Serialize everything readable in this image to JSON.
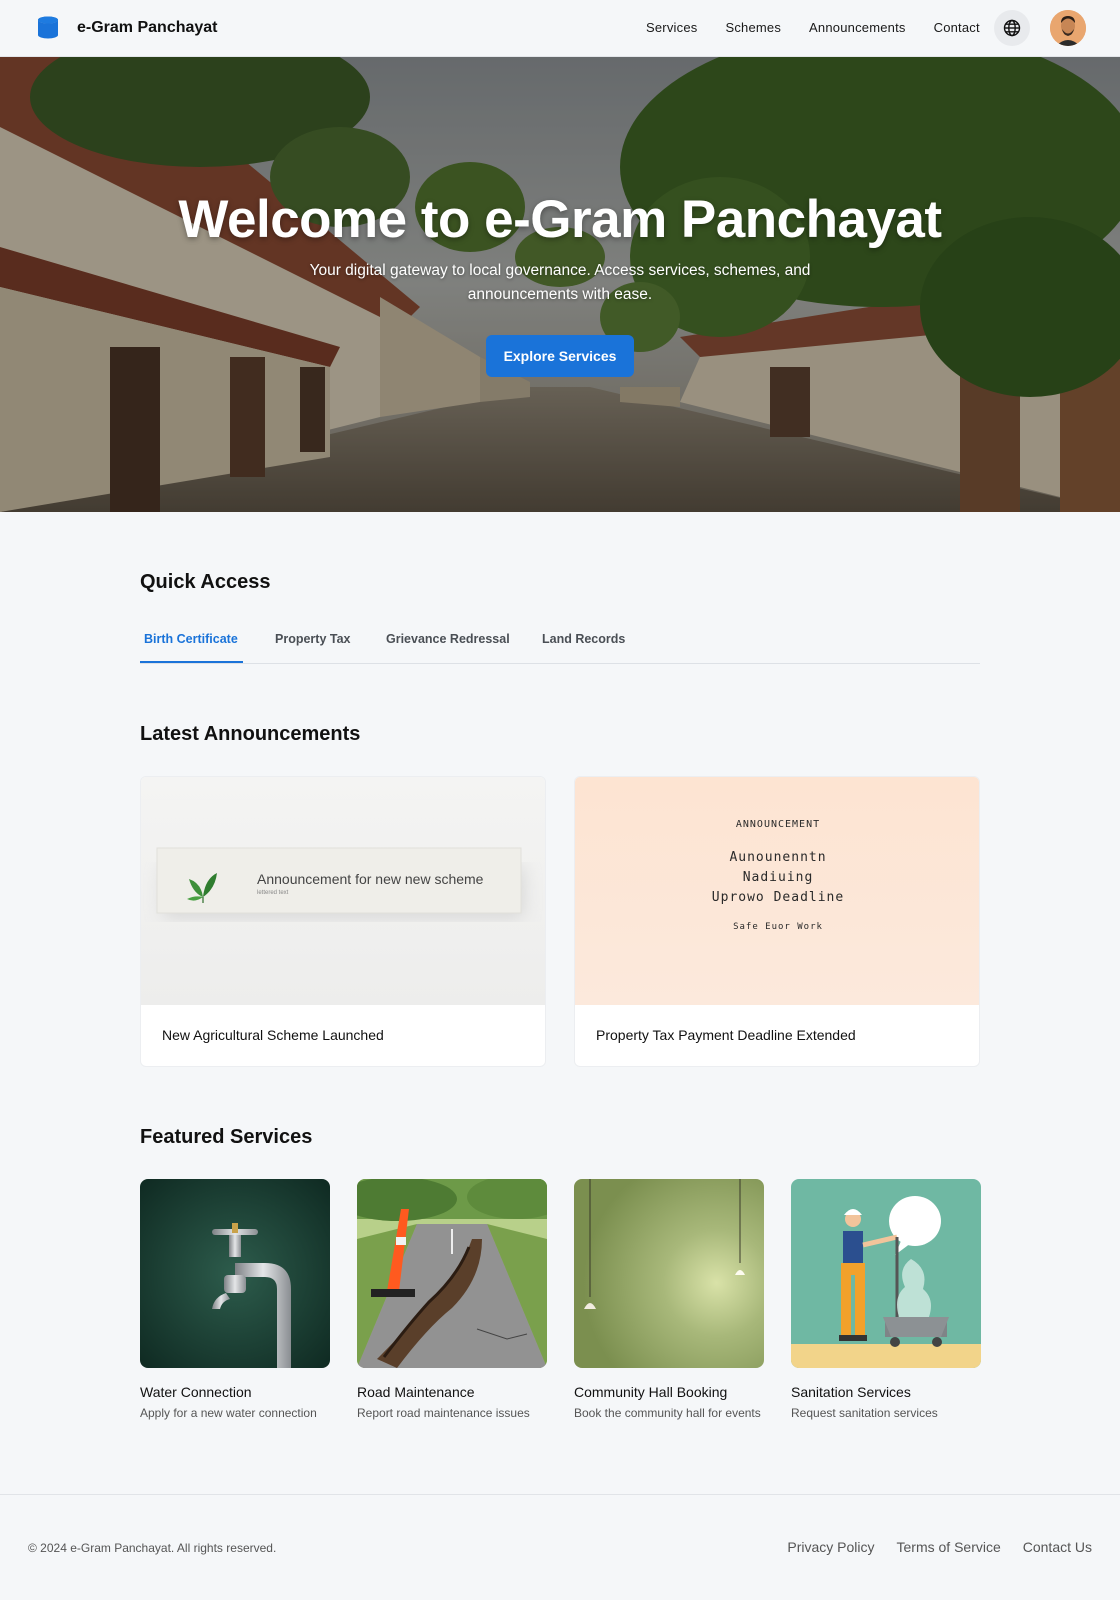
{
  "header": {
    "brand": "e-Gram Panchayat",
    "nav": [
      "Services",
      "Schemes",
      "Announcements",
      "Contact"
    ],
    "globe_icon": "globe-icon",
    "avatar_icon": "user-avatar"
  },
  "hero": {
    "title": "Welcome to e-Gram Panchayat",
    "subtitle": "Your digital gateway to local governance. Access services, schemes, and announcements with ease.",
    "cta": "Explore Services"
  },
  "quick_access": {
    "title": "Quick Access",
    "tabs": [
      "Birth Certificate",
      "Property Tax",
      "Grievance Redressal",
      "Land Records"
    ],
    "active_tab": "Birth Certificate"
  },
  "announcements": {
    "title": "Latest Announcements",
    "items": [
      {
        "caption": "New Agricultural Scheme Launched",
        "image_text": "Announcement for new new scheme",
        "image_small": "lettered text"
      },
      {
        "caption": "Property Tax Payment Deadline Extended",
        "image_heading": "ANNOUNCEMENT",
        "image_lines": [
          "Aunounenntn",
          "Nadiuing",
          "Uprowo Deadline"
        ],
        "image_footer": "Safe Euor Work"
      }
    ]
  },
  "services": {
    "title": "Featured Services",
    "items": [
      {
        "title": "Water Connection",
        "desc": "Apply for a new water connection"
      },
      {
        "title": "Road Maintenance",
        "desc": "Report road maintenance issues"
      },
      {
        "title": "Community Hall Booking",
        "desc": "Book the community hall for events"
      },
      {
        "title": "Sanitation Services",
        "desc": "Request sanitation services"
      }
    ]
  },
  "footer": {
    "copyright": "© 2024 e-Gram Panchayat. All rights reserved.",
    "links": [
      "Privacy Policy",
      "Terms of Service",
      "Contact Us"
    ]
  },
  "colors": {
    "accent": "#1a73d9",
    "background": "#f5f7f9"
  }
}
